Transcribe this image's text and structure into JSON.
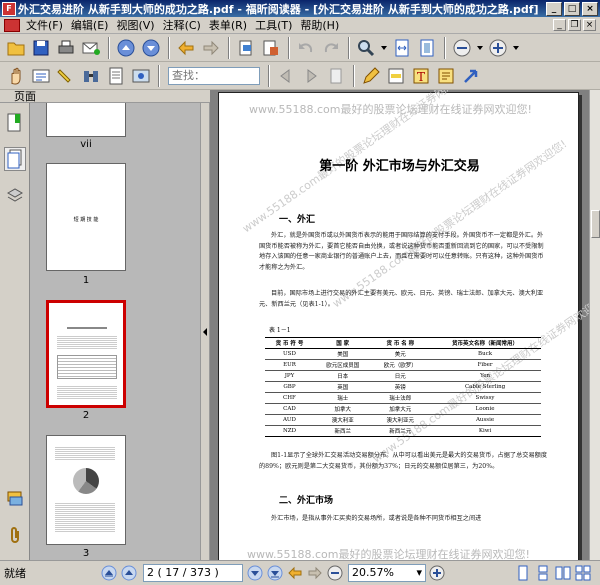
{
  "window": {
    "title": "外汇交易进阶 从新手到大师的成功之路.pdf - 福昕阅读器 - [外汇交易进阶 从新手到大师的成功之路.pdf]",
    "app_icon_text": "F"
  },
  "menu": [
    {
      "label": "文件(F)"
    },
    {
      "label": "编辑(E)"
    },
    {
      "label": "视图(V)"
    },
    {
      "label": "注释(C)"
    },
    {
      "label": "表单(R)"
    },
    {
      "label": "工具(T)"
    },
    {
      "label": "帮助(H)"
    }
  ],
  "toolbar2": {
    "search_placeholder": "查找："
  },
  "sidebar": {
    "panel_title": "页面"
  },
  "thumbnails": [
    {
      "label": "vii"
    },
    {
      "label": "1",
      "title": "短 期 技 能"
    },
    {
      "label": "2",
      "selected": true
    },
    {
      "label": "3"
    }
  ],
  "document": {
    "watermark": "www.55188.com最好的股票论坛理财在线证券网欢迎您!",
    "chapter_title": "第一阶 外汇市场与外汇交易",
    "section1": "一、外汇",
    "para1": "外汇，就是外国货币或以外国货币表示的能用于国际结算的支付手段。外国货币不一定都是外汇。外国货币能否被称为外汇，要首它能否自由兑换，或者说这种货币能否重新回流到它的国家，可以不受限制地存入该国的任意一家商业银行的普通账户上去，而且在需要时可以任意转账。只有这种，这种外国货币才能称之为外汇。",
    "para2": "目前，国际市场上进行交易的外汇主要有美元、欧元、日元、英镑、瑞士法郎、加拿大元、澳大利亚元、新西兰元（见表1-1）。",
    "table_caption": "表 1－1",
    "table_headers": [
      "货 币 符 号",
      "国 家",
      "货 币 名 称",
      "货币英文名称（新闻常用）"
    ],
    "table_rows": [
      [
        "USD",
        "美国",
        "美元",
        "Buck"
      ],
      [
        "EUR",
        "欧元区成员国",
        "欧元（欧罗）",
        "Fiber"
      ],
      [
        "JPY",
        "日本",
        "日元",
        "Yen"
      ],
      [
        "GBP",
        "英国",
        "英镑",
        "Cable Sterling"
      ],
      [
        "CHF",
        "瑞士",
        "瑞士法郎",
        "Swissy"
      ],
      [
        "CAD",
        "加拿大",
        "加拿大元",
        "Loonie"
      ],
      [
        "AUD",
        "澳大利亚",
        "澳大利亚元",
        "Aussie"
      ],
      [
        "NZD",
        "新西兰",
        "新西兰元",
        "Kiwi"
      ]
    ],
    "para3": "图1-1显示了全球外汇交易活动交易额分布。从中可以看出美元是最大的交易货币，占据了总交易额度的89%；欧元则是第二大交易货币，其份额为37%；日元的交易额位居第三，为20%。",
    "section2": "二、外汇市场",
    "para4": "外汇市场，是指从事外汇买卖的交易场所，或者说是各种不同货币相互之间进"
  },
  "status": {
    "text": "就绪",
    "page_value": "2",
    "page_info": "( 17 / 373 )",
    "zoom": "20.57%"
  },
  "colors": {
    "titlebar": "#0a246a",
    "selection": "#cc0000",
    "chrome": "#d4d0c8"
  }
}
